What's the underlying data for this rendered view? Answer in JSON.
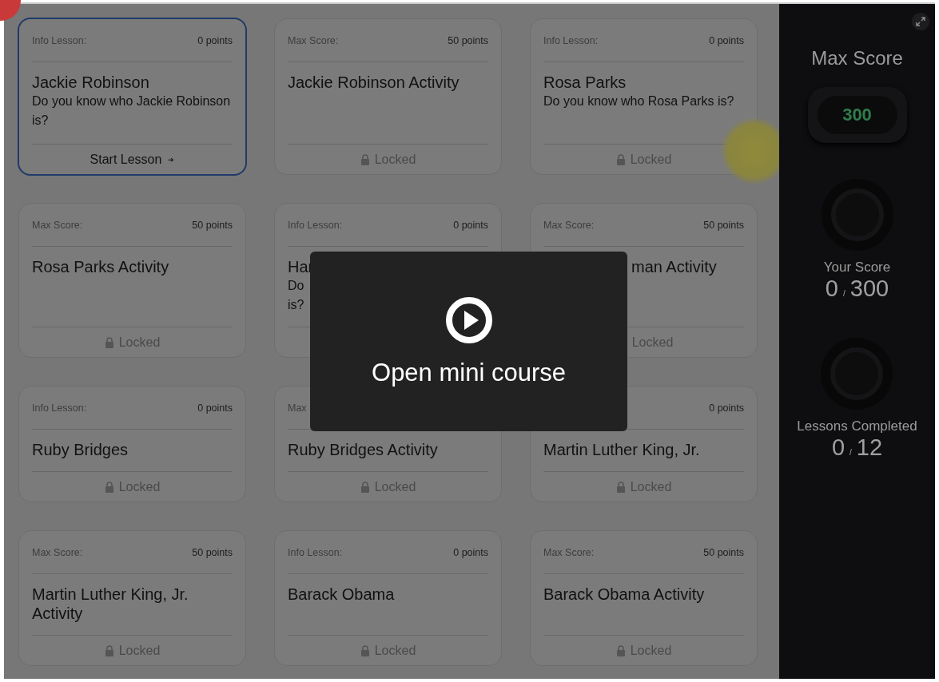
{
  "lessons": [
    {
      "label": "Info Lesson:",
      "points": "0 points",
      "title": "Jackie Robinson",
      "description": "Do you know who Jackie Robinson is?",
      "footer": {
        "kind": "start",
        "text": "Start Lesson",
        "arrow": "➔"
      },
      "selected": true
    },
    {
      "label": "Max Score:",
      "points": "50 points",
      "title": "Jackie Robinson Activity",
      "footer": {
        "kind": "locked",
        "text": "Locked",
        "lock_icon": true
      },
      "selected": false
    },
    {
      "label": "Info Lesson:",
      "points": "0 points",
      "title": "Rosa Parks",
      "description": "Do you know who Rosa Parks is?",
      "footer": {
        "kind": "locked",
        "text": "Locked",
        "lock_icon": true
      },
      "selected": false
    },
    {
      "label": "Max Score:",
      "points": "50 points",
      "title": "Rosa Parks Activity",
      "footer": {
        "kind": "locked",
        "text": "Locked",
        "lock_icon": true
      },
      "selected": false
    },
    {
      "label": "Info Lesson:",
      "points": "0 points",
      "title": "Har",
      "description_lines": [
        "Do",
        "is?"
      ],
      "selected": false
    },
    {
      "label": "Max Score:",
      "points": "50 points",
      "title": "man Activity",
      "title_start_hidden": true,
      "footer": {
        "kind": "locked",
        "text": "Locked",
        "lock_icon": false
      },
      "selected": false
    },
    {
      "label": "Info Lesson:",
      "points": "0 points",
      "title": "Ruby Bridges",
      "footer": {
        "kind": "locked",
        "text": "Locked",
        "lock_icon": true
      },
      "selected": false
    },
    {
      "label": "Max",
      "title": "Ruby Bridges Activity",
      "footer": {
        "kind": "locked",
        "text": "Locked",
        "lock_icon": true
      },
      "selected": false
    },
    {
      "points": "0 points",
      "title": "Martin Luther King, Jr.",
      "footer": {
        "kind": "locked",
        "text": "Locked",
        "lock_icon": true
      },
      "selected": false
    },
    {
      "label": "Max Score:",
      "points": "50 points",
      "title": "Martin Luther King, Jr. Activity",
      "footer": {
        "kind": "locked",
        "text": "Locked",
        "lock_icon": true
      },
      "selected": false
    },
    {
      "label": "Info Lesson:",
      "points": "0 points",
      "title": "Barack Obama",
      "footer": {
        "kind": "locked",
        "text": "Locked",
        "lock_icon": true
      },
      "selected": false
    },
    {
      "label": "Max Score:",
      "points": "50 points",
      "title": "Barack Obama Activity",
      "footer": {
        "kind": "locked",
        "text": "Locked",
        "lock_icon": true
      },
      "selected": false
    }
  ],
  "modal": {
    "text": "Open mini course"
  },
  "sidebar": {
    "max_score_title": "Max Score",
    "max_score": "300",
    "stats": [
      {
        "label": "Your Score",
        "value": "0",
        "separator": "/",
        "total": "300"
      },
      {
        "label": "Lessons Completed",
        "value": "0",
        "separator": "/",
        "total": "12"
      }
    ]
  }
}
